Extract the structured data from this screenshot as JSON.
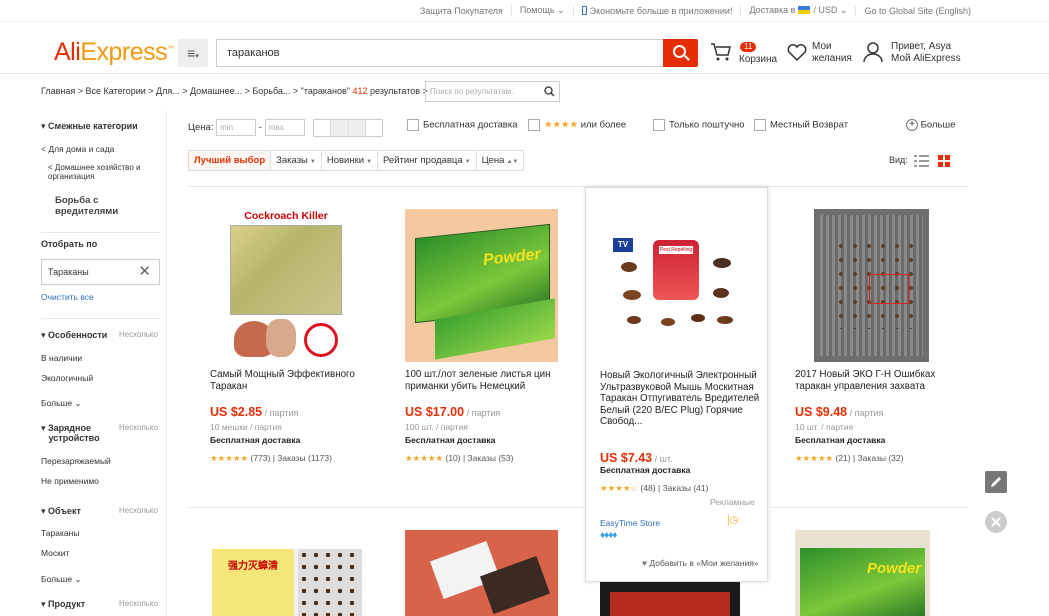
{
  "topbar": {
    "items": [
      "Защита Покупателя",
      "Помощь ⌄",
      "Экономьте больше в приложении!",
      "Доставка в",
      "/ USD ⌄",
      "Go to Global Site (English)"
    ]
  },
  "header": {
    "logo_a": "Ali",
    "logo_b": "Express",
    "search_value": "тараканов",
    "cart_count": "11",
    "cart_label": "Корзина",
    "wishlist_line1": "Мои",
    "wishlist_line2": "желания",
    "account_line1": "Привет, Asya",
    "account_line2": "Мой AliExpress"
  },
  "breadcrumb": {
    "path": "Главная > Все Категории > Для... > Домашнее... > Борьба... > ",
    "query": "\"тараканов\"",
    "count": "412",
    "suffix": " результатов >",
    "in_search_placeholder": "Поиск по результатам."
  },
  "sidebar": {
    "related_title": "Смежные категории",
    "cat1": "< Для дома и сада",
    "cat2a": "< Домашнее хозяйство и",
    "cat2b": "организация",
    "cat3a": "Борьба с",
    "cat3b": "вредителями",
    "filter_title": "Отобрать по",
    "filter_value": "Тараканы",
    "clear_all": "Очистить все",
    "features_title": "Особенности",
    "multi": "Несколько",
    "feat1": "В наличии",
    "feat2": "Экологичный",
    "more": "Больше",
    "charger_title_a": "Зарядное",
    "charger_title_b": "устройство",
    "charger1": "Перезаряжаемый",
    "charger2": "Не применимо",
    "object_title": "Объект",
    "object1": "Тараканы",
    "object2": "Москит",
    "product_title": "Продукт"
  },
  "filters": {
    "price_label": "Цена:",
    "min_placeholder": "min",
    "max_placeholder": "max",
    "free_shipping": "Бесплатная доставка",
    "stars_label": "★★★★",
    "or_more": "или более",
    "single": "Только поштучно",
    "local_return": "Местный Возврат",
    "more": "Больше"
  },
  "sort": {
    "items": [
      "Лучший выбор",
      "Заказы",
      "Новинки",
      "Рейтинг продавца",
      "Цена"
    ],
    "view_label": "Вид:"
  },
  "products": [
    {
      "title": "Самый Мощный Эффективного Таракан",
      "price": "US $2.85",
      "unit": " / партия",
      "lot": "10 мешки / партия",
      "shipping": "Бесплатная доставка",
      "stars": "★★★★★",
      "reviews": "(773)",
      "orders": "Заказы (1173)",
      "image_caption": "Cockroach Killer"
    },
    {
      "title": "100 шт./лот зеленые листья цин приманки убить Немецкий",
      "price": "US $17.00",
      "unit": " / партия",
      "lot": "100 шт. / партия",
      "shipping": "Бесплатная доставка",
      "stars": "★★★★★",
      "reviews": "(10)",
      "orders": "Заказы (53)",
      "image_caption": "Powder"
    },
    {
      "title": "Новый Экологичный Электронный Ультразвуковой Мышь Москитная Таракан Отпугиватель Вредителей Белый (220 В/EC Plug) Горячие Свобод...",
      "price": "US $7.43",
      "unit": " / шт.",
      "shipping": "Бесплатная доставка",
      "stars": "★★★★☆",
      "reviews": "(48)",
      "orders": "Заказы (41)",
      "ad": "Рекламные",
      "store": "EasyTime Store",
      "wish": "Добавить в «Мои желания»",
      "image_caption": "Pest Repelling Aid"
    },
    {
      "title": "2017 Новый ЭКО Г-Н Ошибках таракан управления захвата",
      "price": "US $9.48",
      "unit": " / партия",
      "lot": "10 шт. / партия",
      "shipping": "Бесплатная доставка",
      "stars": "★★★★★",
      "reviews": "(21)",
      "orders": "Заказы (32)"
    }
  ],
  "row2": {
    "img1_caption": "强力灭蟑清",
    "img4_caption": "Powder"
  }
}
